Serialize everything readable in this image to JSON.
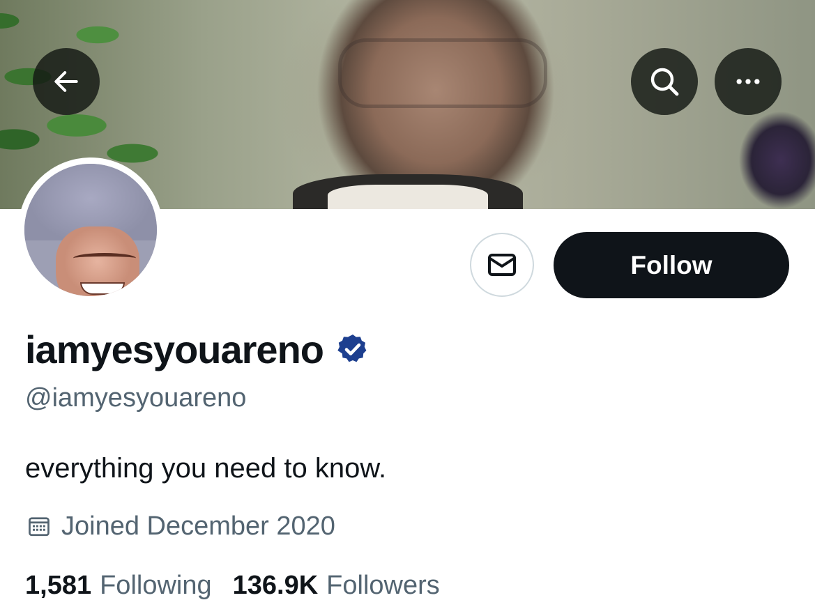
{
  "header": {
    "back_icon": "arrow-left-icon",
    "search_icon": "search-icon",
    "more_icon": "more-horizontal-icon"
  },
  "profile": {
    "display_name": "iamyesyouareno",
    "verified_icon": "verified-badge-icon",
    "verified_color": "#1d3f8f",
    "handle": "@iamyesyouareno",
    "bio": "everything you need to know.",
    "joined_icon": "calendar-icon",
    "joined": "Joined December 2020"
  },
  "actions": {
    "message_icon": "mail-icon",
    "follow_label": "Follow"
  },
  "stats": {
    "following_count": "1,581",
    "following_label": "Following",
    "followers_count": "136.9K",
    "followers_label": "Followers"
  },
  "colors": {
    "primary_text": "#0f1419",
    "secondary_text": "#536471",
    "follow_button_bg": "#0f1419",
    "border": "#cfd9de"
  }
}
